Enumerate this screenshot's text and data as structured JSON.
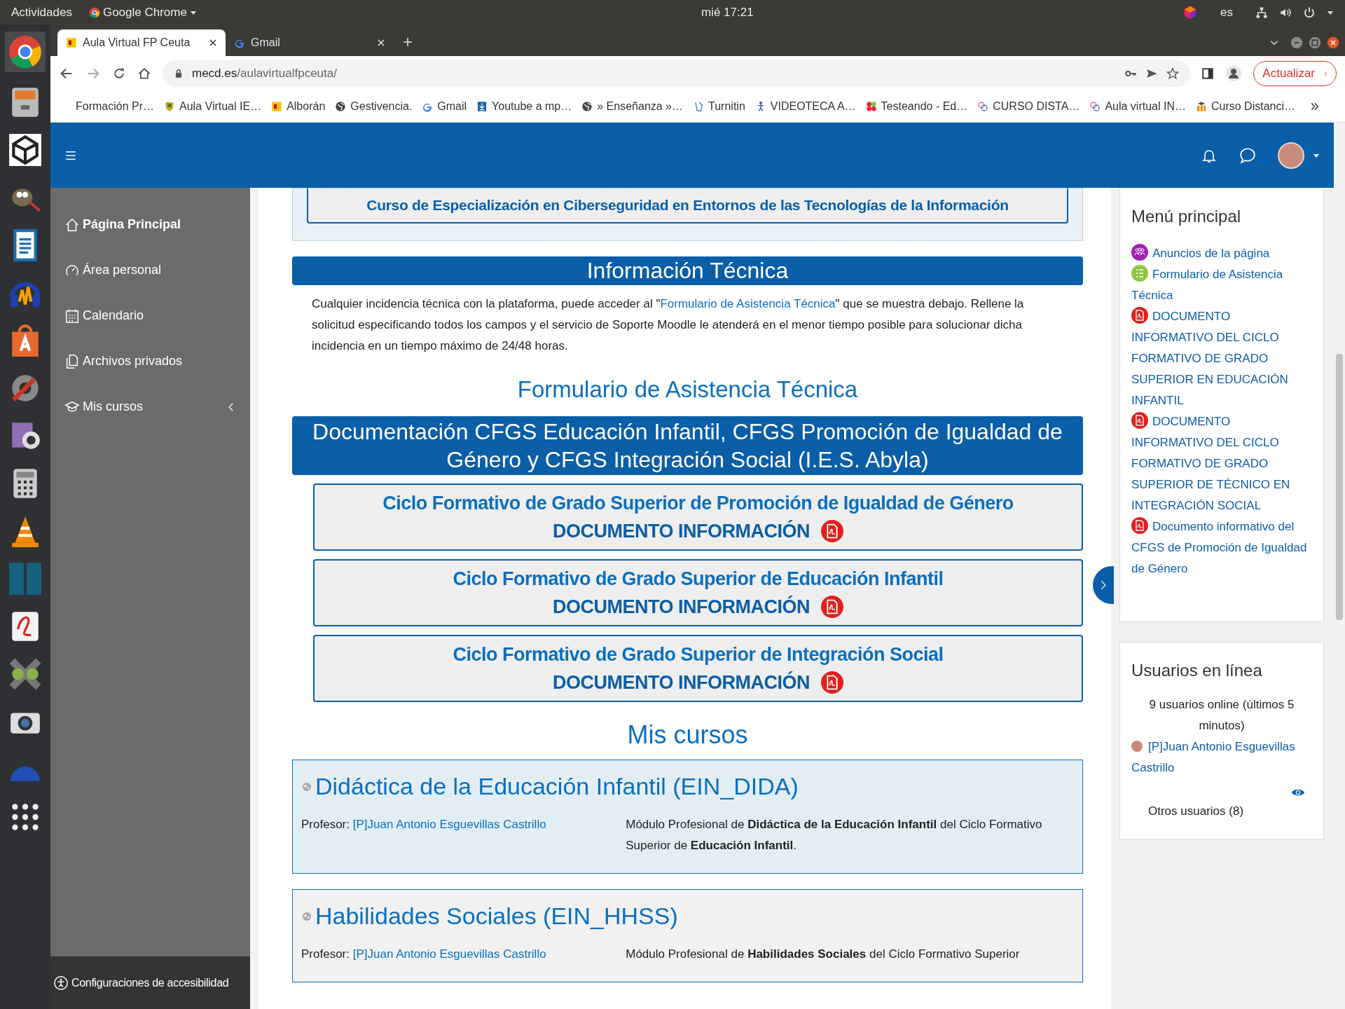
{
  "system_bar": {
    "activities": "Actividades",
    "app_menu": "Google Chrome",
    "clock": "mié 17:21",
    "input_language": "es"
  },
  "browser": {
    "tabs": [
      {
        "title": "Aula Virtual FP Ceuta",
        "selected": true
      },
      {
        "title": "Gmail",
        "selected": false
      }
    ],
    "address": {
      "domain": "mecd.es",
      "path": "/aulavirtualfpceuta/"
    },
    "update_button": "Actualizar",
    "bookmarks": [
      "Formación Pr…",
      "Aula Virtual IE…",
      "Alborán",
      "Gestivencia.",
      "Gmail",
      "Youtube a mp…",
      "» Enseñanza »…",
      "Turnitin",
      "VIDEOTECA A…",
      "Testeando - Ed…",
      "CURSO DISTA…",
      "Aula virtual IN…",
      "Curso Distanci…"
    ]
  },
  "nav_drawer": {
    "items": [
      {
        "label": "Página Principal",
        "selected": true,
        "kind": "link"
      },
      {
        "label": "Área personal",
        "selected": false,
        "kind": "link"
      },
      {
        "label": "Calendario",
        "selected": false,
        "kind": "link"
      },
      {
        "label": "Archivos privados",
        "selected": false,
        "kind": "link"
      },
      {
        "label": "Mis cursos",
        "selected": false,
        "kind": "group"
      }
    ],
    "footer": "Configuraciones de accesibilidad"
  },
  "main": {
    "banner_course": "Curso de Especialización en Ciberseguridad en Entornos de las Tecnologías de la Información",
    "info_heading": "Información Técnica",
    "info_paragraph": {
      "before": "Cualquier incidencia técnica con la plataforma, puede acceder al \"",
      "link": "Formulario de Asistencia Técnica",
      "after": "\" que se muestra debajo. Rellene la solicitud especificando todos los campos y el servicio de Soporte Moodle le atenderá en el menor tiempo posible para solucionar dicha incidencia en un tiempo máximo de 24/48 horas."
    },
    "form_heading": "Formulario de Asistencia Técnica",
    "docs_heading": "Documentación CFGS Educación Infantil, CFGS Promoción de Igualdad de Género y CFGS Integración Social (I.E.S. Abyla)",
    "doc_cards": [
      {
        "title": "Ciclo Formativo de Grado Superior de Promoción de Igualdad de Género",
        "link": "DOCUMENTO INFORMACIÓN"
      },
      {
        "title": "Ciclo Formativo de Grado Superior de Educación Infantil",
        "link": "DOCUMENTO INFORMACIÓN"
      },
      {
        "title": "Ciclo Formativo de Grado Superior de Integración Social",
        "link": "DOCUMENTO INFORMACIÓN"
      }
    ],
    "courses_heading": "Mis cursos",
    "courses": [
      {
        "title": "Didáctica de la Educación Infantil (EIN_DIDA)",
        "teacher_label": "Profesor:",
        "teacher": "[P]Juan Antonio Esguevillas Castrillo",
        "summary": "Módulo Profesional de **Didáctica de la Educación Infantil** del Ciclo Formativo Superior de **Educación Infantil**."
      },
      {
        "title": "Habilidades Sociales (EIN_HHSS)",
        "teacher_label": "Profesor:",
        "teacher": "[P]Juan Antonio Esguevillas Castrillo",
        "summary": "Módulo Profesional de **Habilidades Sociales** del Ciclo Formativo Superior"
      }
    ]
  },
  "sidebar": {
    "main_menu": {
      "title": "Menú principal",
      "items": [
        {
          "kind": "forum",
          "label": "Anuncios de la página"
        },
        {
          "kind": "form",
          "label": "Formulario de Asistencia Técnica"
        },
        {
          "kind": "pdf",
          "label": "DOCUMENTO INFORMATIVO DEL CICLO FORMATIVO DE GRADO SUPERIOR EN EDUCACIÓN INFANTIL"
        },
        {
          "kind": "pdf",
          "label": "DOCUMENTO INFORMATIVO DEL CICLO FORMATIVO DE GRADO SUPERIOR DE TÉCNICO EN INTEGRACIÓN SOCIAL"
        },
        {
          "kind": "pdf",
          "label": "Documento informativo del CFGS de Promoción de Igualdad de Género"
        }
      ]
    },
    "online_users": {
      "title": "Usuarios en línea",
      "summary": "9 usuarios online (últimos 5 minutos)",
      "users": [
        "[P]Juan Antonio Esguevillas Castrillo"
      ],
      "others": "Otros usuarios (8)"
    }
  }
}
